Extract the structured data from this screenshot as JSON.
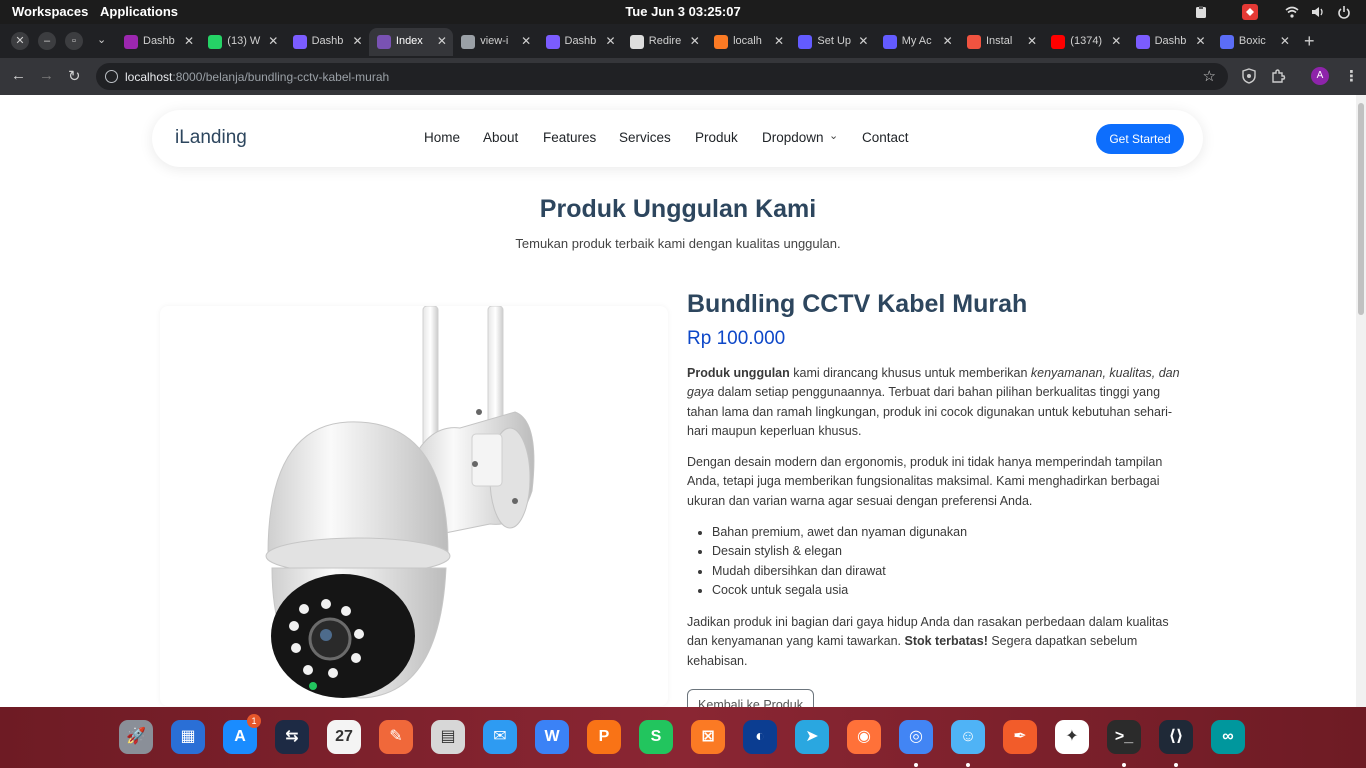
{
  "topbar": {
    "workspaces": "Workspaces",
    "applications": "Applications",
    "clock": "Tue Jun 3  03:25:07"
  },
  "tabs": [
    {
      "title": "Dashb",
      "favicon": "dashboard-icon",
      "color": "#9c27b0"
    },
    {
      "title": "(13) W",
      "favicon": "whatsapp-icon",
      "color": "#25d366"
    },
    {
      "title": "Dashb",
      "favicon": "feather-icon",
      "color": "#7b5cff"
    },
    {
      "title": "Index",
      "favicon": "bootstrap-icon",
      "color": "#7952b3"
    },
    {
      "title": "view-i",
      "favicon": "globe-icon",
      "color": "#9aa0a6"
    },
    {
      "title": "Dashb",
      "favicon": "feather-icon",
      "color": "#7b5cff"
    },
    {
      "title": "Redire",
      "favicon": "github-icon",
      "color": "#dddddd"
    },
    {
      "title": "localh",
      "favicon": "xampp-icon",
      "color": "#fb7a24"
    },
    {
      "title": "Set Up",
      "favicon": "stripe-icon",
      "color": "#635bff"
    },
    {
      "title": "My Ac",
      "favicon": "stripe-icon",
      "color": "#635bff"
    },
    {
      "title": "Instal",
      "favicon": "laravel-icon",
      "color": "#f05340"
    },
    {
      "title": "(1374)",
      "favicon": "youtube-icon",
      "color": "#ff0000"
    },
    {
      "title": "Dashb",
      "favicon": "feather-icon",
      "color": "#7b5cff"
    },
    {
      "title": "Boxic",
      "favicon": "boxicons-icon",
      "color": "#5b6df6"
    }
  ],
  "address": {
    "host": "localhost",
    "path": ":8000/belanja/bundling-cctv-kabel-murah"
  },
  "profile": {
    "initial": "A"
  },
  "site": {
    "brand": "iLanding",
    "nav": [
      "Home",
      "About",
      "Features",
      "Services",
      "Produk",
      "Dropdown",
      "Contact"
    ],
    "cta": "Get Started"
  },
  "section": {
    "title": "Produk Unggulan Kami",
    "subtitle": "Temukan produk terbaik kami dengan kualitas unggulan."
  },
  "product": {
    "name": "Bundling CCTV Kabel Murah",
    "price": "Rp 100.000",
    "p1_strong": "Produk unggulan",
    "p1_a": " kami dirancang khusus untuk memberikan ",
    "p1_em": "kenyamanan, kualitas, dan gaya",
    "p1_b": " dalam setiap penggunaannya. Terbuat dari bahan pilihan berkualitas tinggi yang tahan lama dan ramah lingkungan, produk ini cocok digunakan untuk kebutuhan sehari-hari maupun keperluan khusus.",
    "p2": "Dengan desain modern dan ergonomis, produk ini tidak hanya memperindah tampilan Anda, tetapi juga memberikan fungsionalitas maksimal. Kami menghadirkan berbagai ukuran dan varian warna agar sesuai dengan preferensi Anda.",
    "features": [
      "Bahan premium, awet dan nyaman digunakan",
      "Desain stylish & elegan",
      "Mudah dibersihkan dan dirawat",
      "Cocok untuk segala usia"
    ],
    "p3_a": "Jadikan produk ini bagian dari gaya hidup Anda dan rasakan perbedaan dalam kualitas dan kenyamanan yang kami tawarkan. ",
    "p3_strong": "Stok terbatas!",
    "p3_b": " Segera dapatkan sebelum kehabisan.",
    "back_button": "Kembali ke Produk"
  },
  "dock": {
    "apps": [
      {
        "name": "launchpad-icon",
        "color": "#8a8f98",
        "glyph": "🚀"
      },
      {
        "name": "app-grid-icon",
        "color": "#2a6fd6",
        "glyph": "▦"
      },
      {
        "name": "app-store-icon",
        "color": "#1a8cff",
        "glyph": "A",
        "badge": "1"
      },
      {
        "name": "remote-desktop-icon",
        "color": "#1d2a44",
        "glyph": "⇆"
      },
      {
        "name": "calendar-icon",
        "color": "#f4f4f4",
        "glyph": "27"
      },
      {
        "name": "pen-editor-icon",
        "color": "#f0683a",
        "glyph": "✎"
      },
      {
        "name": "calculator-icon",
        "color": "#d7d7d7",
        "glyph": "▤"
      },
      {
        "name": "mail-icon",
        "color": "#2e9bf2",
        "glyph": "✉"
      },
      {
        "name": "writer-icon",
        "color": "#3b82f6",
        "glyph": "W"
      },
      {
        "name": "presentation-icon",
        "color": "#f97316",
        "glyph": "P"
      },
      {
        "name": "spreadsheet-icon",
        "color": "#22c55e",
        "glyph": "S"
      },
      {
        "name": "xampp-icon",
        "color": "#fb7a24",
        "glyph": "⊠"
      },
      {
        "name": "globe-browser-icon",
        "color": "#0b3d91",
        "glyph": "◐"
      },
      {
        "name": "telegram-icon",
        "color": "#2aa7e0",
        "glyph": "➤"
      },
      {
        "name": "firefox-icon",
        "color": "#ff7139",
        "glyph": "◉"
      },
      {
        "name": "chrome-icon",
        "color": "#4285f4",
        "glyph": "◎"
      },
      {
        "name": "finder-icon",
        "color": "#4fb3f6",
        "glyph": "☺"
      },
      {
        "name": "pen-tool-icon",
        "color": "#f25c2a",
        "glyph": "✒"
      },
      {
        "name": "beaver-icon",
        "color": "#ffffff",
        "glyph": "✦"
      },
      {
        "name": "terminal-icon",
        "color": "#2b2b2b",
        "glyph": ">_"
      },
      {
        "name": "vscode-icon",
        "color": "#1f2937",
        "glyph": "⟨⟩"
      },
      {
        "name": "arduino-icon",
        "color": "#00979d",
        "glyph": "∞"
      }
    ]
  }
}
